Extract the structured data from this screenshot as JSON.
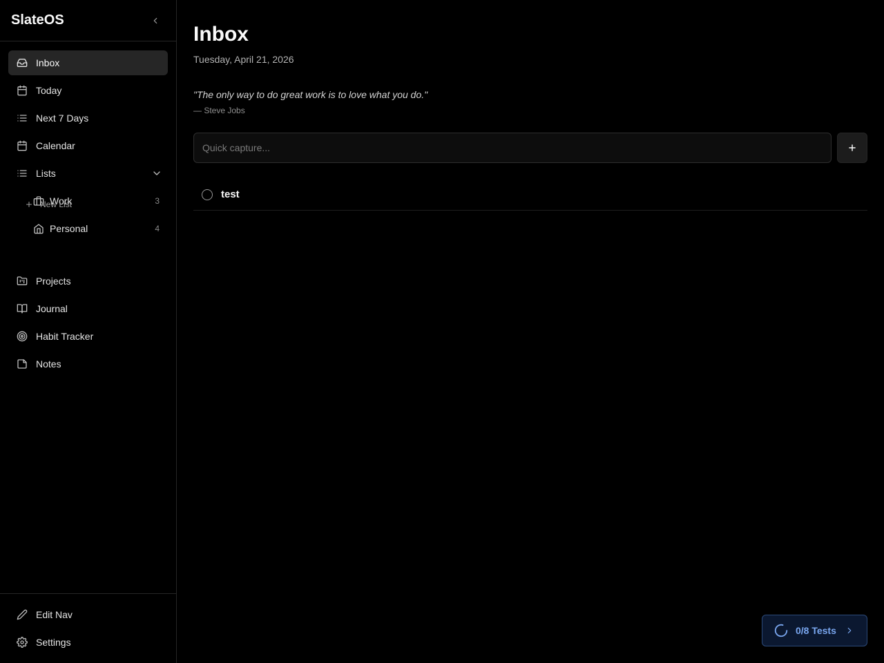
{
  "app": {
    "name": "SlateOS"
  },
  "sidebar": {
    "items": [
      {
        "label": "Inbox",
        "icon": "inbox-icon"
      },
      {
        "label": "Today",
        "icon": "calendar-icon"
      },
      {
        "label": "Next 7 Days",
        "icon": "list-icon"
      },
      {
        "label": "Calendar",
        "icon": "calendar-icon"
      },
      {
        "label": "Lists",
        "icon": "list-icon"
      }
    ],
    "lists": [
      {
        "label": "Work",
        "count": "3",
        "icon": "briefcase-icon"
      },
      {
        "label": "Personal",
        "count": "4",
        "icon": "home-icon"
      }
    ],
    "new_list_label": "New List",
    "more_items": [
      {
        "label": "Projects",
        "icon": "folder-kanban-icon"
      },
      {
        "label": "Journal",
        "icon": "book-icon"
      },
      {
        "label": "Habit Tracker",
        "icon": "target-icon"
      },
      {
        "label": "Notes",
        "icon": "note-icon"
      }
    ],
    "bottom_items": [
      {
        "label": "Edit Nav",
        "icon": "pencil-icon"
      },
      {
        "label": "Settings",
        "icon": "gear-icon"
      }
    ]
  },
  "main": {
    "title": "Inbox",
    "date": "Tuesday, April 21, 2026",
    "quote": "\"The only way to do great work is to love what you do.\"",
    "quote_author": "— Steve Jobs",
    "capture_placeholder": "Quick capture...",
    "tasks": [
      {
        "title": "test",
        "done": false
      }
    ]
  },
  "tests": {
    "label": "0/8 Tests",
    "passed": 0,
    "total": 8
  },
  "colors": {
    "background": "#000000",
    "active_nav": "#262626",
    "accent": "#7aa7f0"
  }
}
